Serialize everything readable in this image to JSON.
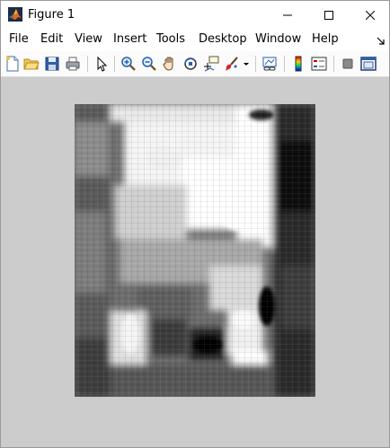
{
  "window": {
    "title": "Figure 1"
  },
  "menu": {
    "items": [
      "File",
      "Edit",
      "View",
      "Insert",
      "Tools",
      "Desktop",
      "Window",
      "Help"
    ]
  },
  "toolbar": {
    "icons": [
      "new-figure-icon",
      "open-file-icon",
      "save-icon",
      "print-icon",
      "edit-plot-arrow-icon",
      "zoom-in-icon",
      "zoom-out-icon",
      "pan-hand-icon",
      "rotate-3d-icon",
      "data-cursor-icon",
      "brush-icon",
      "brush-dropdown-icon",
      "link-plot-icon",
      "insert-colorbar-icon",
      "insert-legend-icon",
      "hide-plot-tools-icon",
      "show-plot-tools-icon"
    ]
  },
  "figure": {
    "background_color": "#cccccc",
    "image_description": "grayscale image plot"
  }
}
